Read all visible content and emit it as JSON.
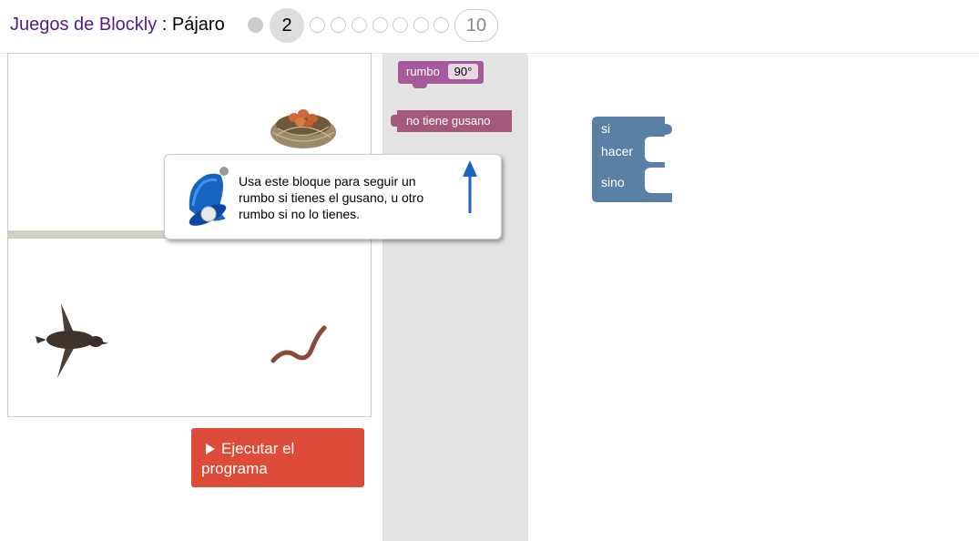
{
  "header": {
    "app_name": "Juegos de Blockly",
    "separator": " : ",
    "game_name": "Pájaro",
    "levels": {
      "current": "2",
      "last": "10",
      "completed": 1,
      "total": 10
    }
  },
  "game": {
    "run_button_label": "Ejecutar el programa",
    "sprites": [
      "nest",
      "bird",
      "worm"
    ]
  },
  "toolbox": {
    "heading_block": {
      "label": "rumbo",
      "value": "90°"
    },
    "worm_block": {
      "label": "no tiene gusano"
    }
  },
  "workspace": {
    "if_block": {
      "if_label": "si",
      "do_label": "hacer",
      "else_label": "sino"
    }
  },
  "tooltip": {
    "text": "Usa este bloque para seguir un rumbo si tienes el gusano, u otro rumbo si no lo tienes.",
    "icon": "bell-icon"
  },
  "colors": {
    "brand_purple": "#551a8b",
    "run_button": "#dd4b39",
    "heading_block": "#a55b9a",
    "condition_block": "#a5597a",
    "logic_block": "#5b80a5",
    "toolbox_bg": "#e4e4e4",
    "wall": "#cfd1c2"
  }
}
